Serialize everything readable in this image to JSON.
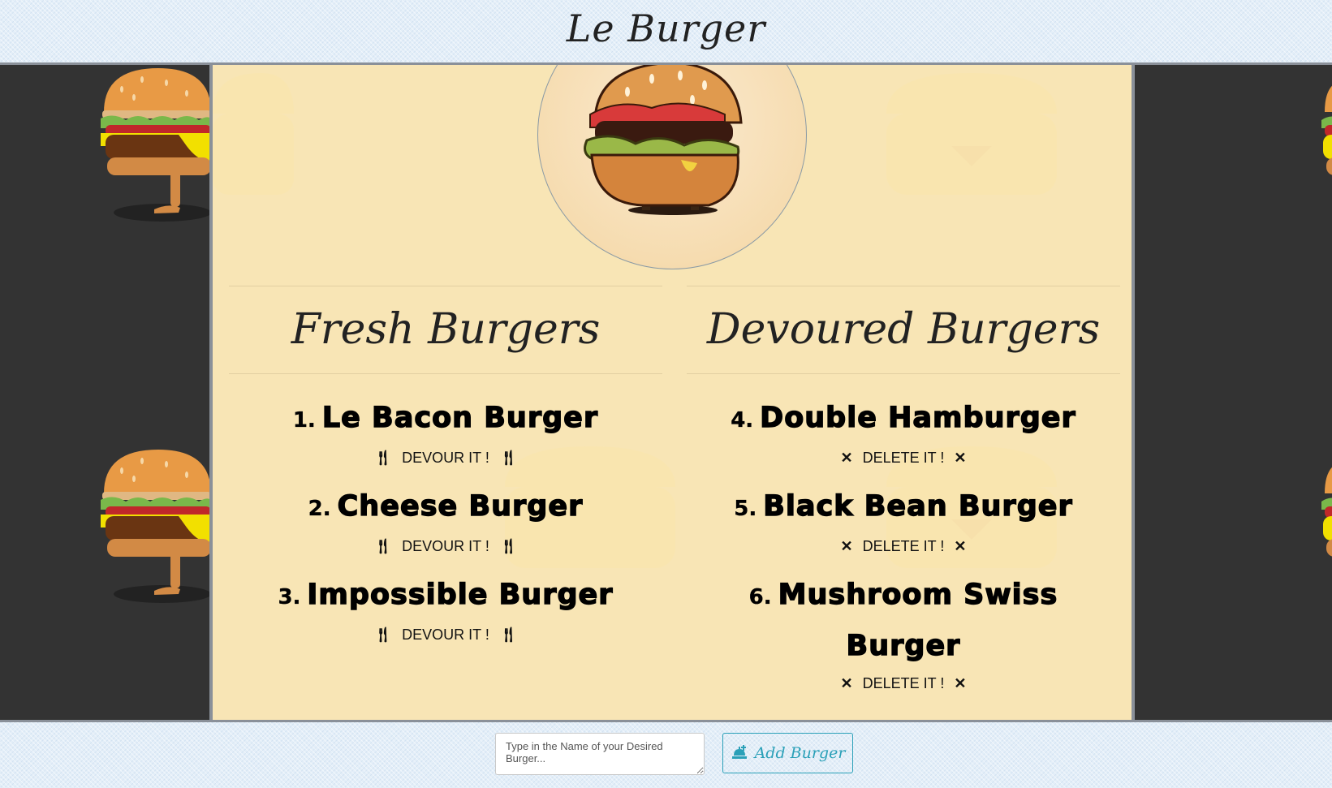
{
  "header": {
    "title": "Le Burger"
  },
  "fresh": {
    "heading": "Fresh Burgers",
    "items": [
      {
        "num": "1.",
        "name": "Le Bacon Burger",
        "action": "DEVOUR IT !"
      },
      {
        "num": "2.",
        "name": "Cheese Burger",
        "action": "DEVOUR IT !"
      },
      {
        "num": "3.",
        "name": "Impossible Burger",
        "action": "DEVOUR IT !"
      }
    ]
  },
  "devoured": {
    "heading": "Devoured Burgers",
    "items": [
      {
        "num": "4.",
        "name": "Double Hamburger",
        "action": "DELETE IT !"
      },
      {
        "num": "5.",
        "name": "Black Bean Burger",
        "action": "DELETE IT !"
      },
      {
        "num": "6.",
        "name": "Mushroom Swiss Burger",
        "action": "DELETE IT !"
      }
    ]
  },
  "footer": {
    "input_placeholder": "Type in the Name of your Desired Burger...",
    "add_label": "Add Burger"
  },
  "icons": {
    "devour": "fork-knife-icon",
    "delete": "close-icon",
    "add": "food-tray-icon"
  },
  "colors": {
    "card_background": "#f8e5b5",
    "side_background": "#333333",
    "header_background": "#e3eef8",
    "accent": "#2aa0b8"
  }
}
